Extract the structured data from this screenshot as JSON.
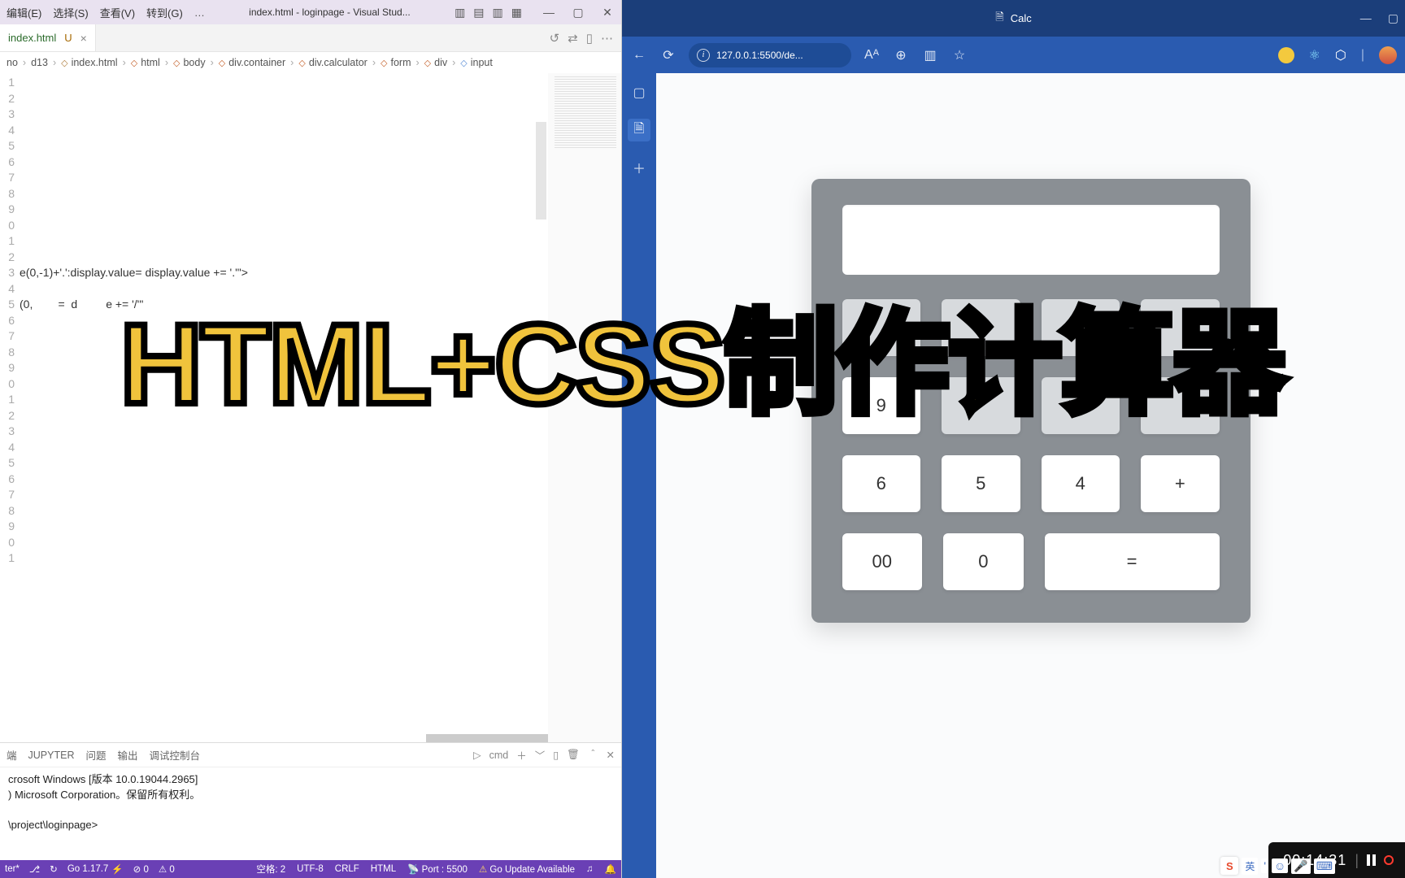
{
  "vscode": {
    "menubar": {
      "edit": "编辑(E)",
      "select": "选择(S)",
      "view": "查看(V)",
      "go": "转到(G)",
      "more": "…",
      "title": "index.html - loginpage - Visual Stud..."
    },
    "tab": {
      "name": "index.html",
      "status": "U"
    },
    "breadcrumb": [
      "no",
      "d13",
      "index.html",
      "html",
      "body",
      "div.container",
      "div.calculator",
      "form",
      "div",
      "input"
    ],
    "code_line_13": "e(0,-1)+'.':display.value= display.value += '.'\">",
    "code_line_15": "(0,        =  d         e += '/'\"",
    "terminal": {
      "tabs": {
        "terminal": "端",
        "jupyter": "JUPYTER",
        "problems": "问题",
        "output": "输出",
        "debug": "调试控制台",
        "shell": "cmd"
      },
      "line1": "crosoft Windows [版本 10.0.19044.2965]",
      "line2": ") Microsoft Corporation。保留所有权利。",
      "line4": "\\project\\loginpage>"
    },
    "status": {
      "left1": "ter*",
      "branch_icon": "⎇",
      "sync_icon": "↻",
      "go": "Go 1.17.7",
      "lightning": "⚡",
      "errors": "⊘ 0",
      "warnings": "⚠ 0",
      "spaces": "空格: 2",
      "encoding": "UTF-8",
      "eol": "CRLF",
      "lang": "HTML",
      "port": "Port : 5500",
      "update": "Go Update Available",
      "bell": "🔔"
    }
  },
  "browser": {
    "title": "Calc",
    "url": "127.0.0.1:5500/de...",
    "addr_icons": {
      "text": "Aᴬ",
      "zoom": "⊕"
    },
    "calc": {
      "row2": [
        "9"
      ],
      "row3": [
        "6",
        "5",
        "4",
        "+"
      ],
      "row4": [
        "00",
        "0",
        "="
      ]
    }
  },
  "watermark": {
    "time": "00:14:31"
  },
  "ime": {
    "sogou": "S",
    "lang": "英"
  },
  "overlay": "HTML+CSS制作计算器"
}
